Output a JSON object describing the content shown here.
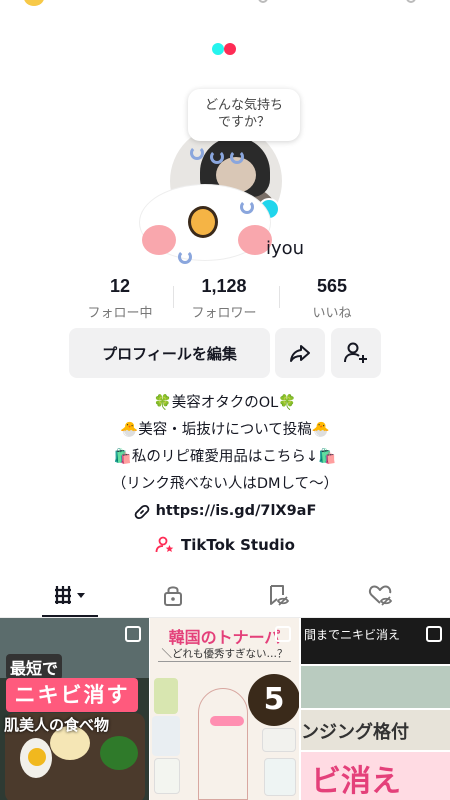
{
  "bubble": {
    "line1": "どんな気持ち",
    "line2": "ですか？"
  },
  "profile": {
    "username_fragment": "iyou"
  },
  "stats": [
    {
      "value": "12",
      "label": "フォロー中"
    },
    {
      "value": "1,128",
      "label": "フォロワー"
    },
    {
      "value": "565",
      "label": "いいね"
    }
  ],
  "actions": {
    "edit_profile": "プロフィールを編集"
  },
  "bio": {
    "line1": "🍀美容オタクのOL🍀",
    "line2": "🐣美容・垢抜けについて投稿🐣",
    "line3": "🛍️私のリピ確愛用品はこちら↓🛍️",
    "line4": "（リンク飛べない人はDMして〜）",
    "link": "https://is.gd/7lX9aF"
  },
  "studio": {
    "label": "TikTok Studio"
  },
  "tabs": [
    {
      "name": "videos",
      "icon": "grid-bars-icon",
      "active": true
    },
    {
      "name": "private",
      "icon": "lock-icon"
    },
    {
      "name": "saved",
      "icon": "bookmark-eye-icon"
    },
    {
      "name": "liked",
      "icon": "heart-eye-icon"
    }
  ],
  "videos": [
    {
      "caption1": "最短で",
      "caption2": "ニキビ消す",
      "caption3": "肌美人の食べ物"
    },
    {
      "caption1": "韓国のトナーパ",
      "caption2": "＼どれも優秀すぎない…？",
      "badge": "5"
    },
    {
      "caption1": "間までニキビ消え",
      "caption2": "ンジング格付",
      "caption3": "ビ消え"
    }
  ],
  "colors": {
    "accent": "#fe2c55",
    "cyan": "#25f4ee",
    "text": "#161823",
    "button_bg": "#f1f1f2",
    "pink": "#e4407a"
  }
}
